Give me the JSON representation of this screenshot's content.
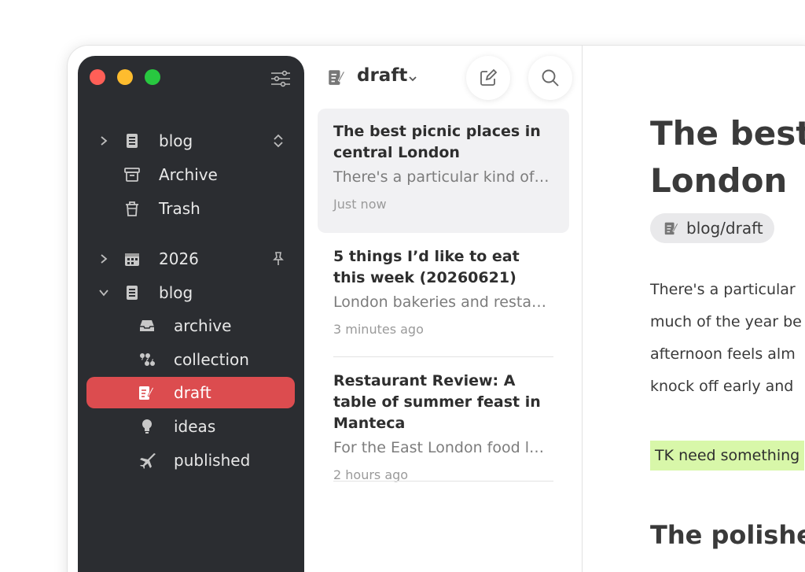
{
  "sidebar": {
    "items": [
      {
        "label": "blog"
      },
      {
        "label": "Archive"
      },
      {
        "label": "Trash"
      },
      {
        "label": "2026"
      },
      {
        "label": "blog"
      },
      {
        "label": "archive"
      },
      {
        "label": "collection"
      },
      {
        "label": "draft"
      },
      {
        "label": "ideas"
      },
      {
        "label": "published"
      }
    ]
  },
  "note_list": {
    "title": "draft",
    "notes": [
      {
        "title": "The best picnic places in central London",
        "snippet": "There's a particular kind of j…",
        "time": "Just now"
      },
      {
        "title": "5 things I’d like to eat this week (20260621)",
        "snippet": "London bakeries and restau…",
        "time": "3 minutes ago"
      },
      {
        "title": "Restaurant Review: A table of summer feast in Manteca",
        "snippet": "For the East London food l…",
        "time": "2 hours ago"
      }
    ]
  },
  "editor": {
    "title": "The best\nLondon",
    "title_line1": "The best",
    "title_line2": "London",
    "tag": "blog/draft",
    "body_lines": [
      "There's a particular",
      "much of the year be",
      "afternoon feels alm",
      "knock off early and"
    ],
    "highlight": "TK need something",
    "heading2": "The polishe"
  },
  "colors": {
    "sidebar_bg": "#2b2d31",
    "active_item": "#dc4c4f",
    "highlight": "#d8f7a9"
  }
}
